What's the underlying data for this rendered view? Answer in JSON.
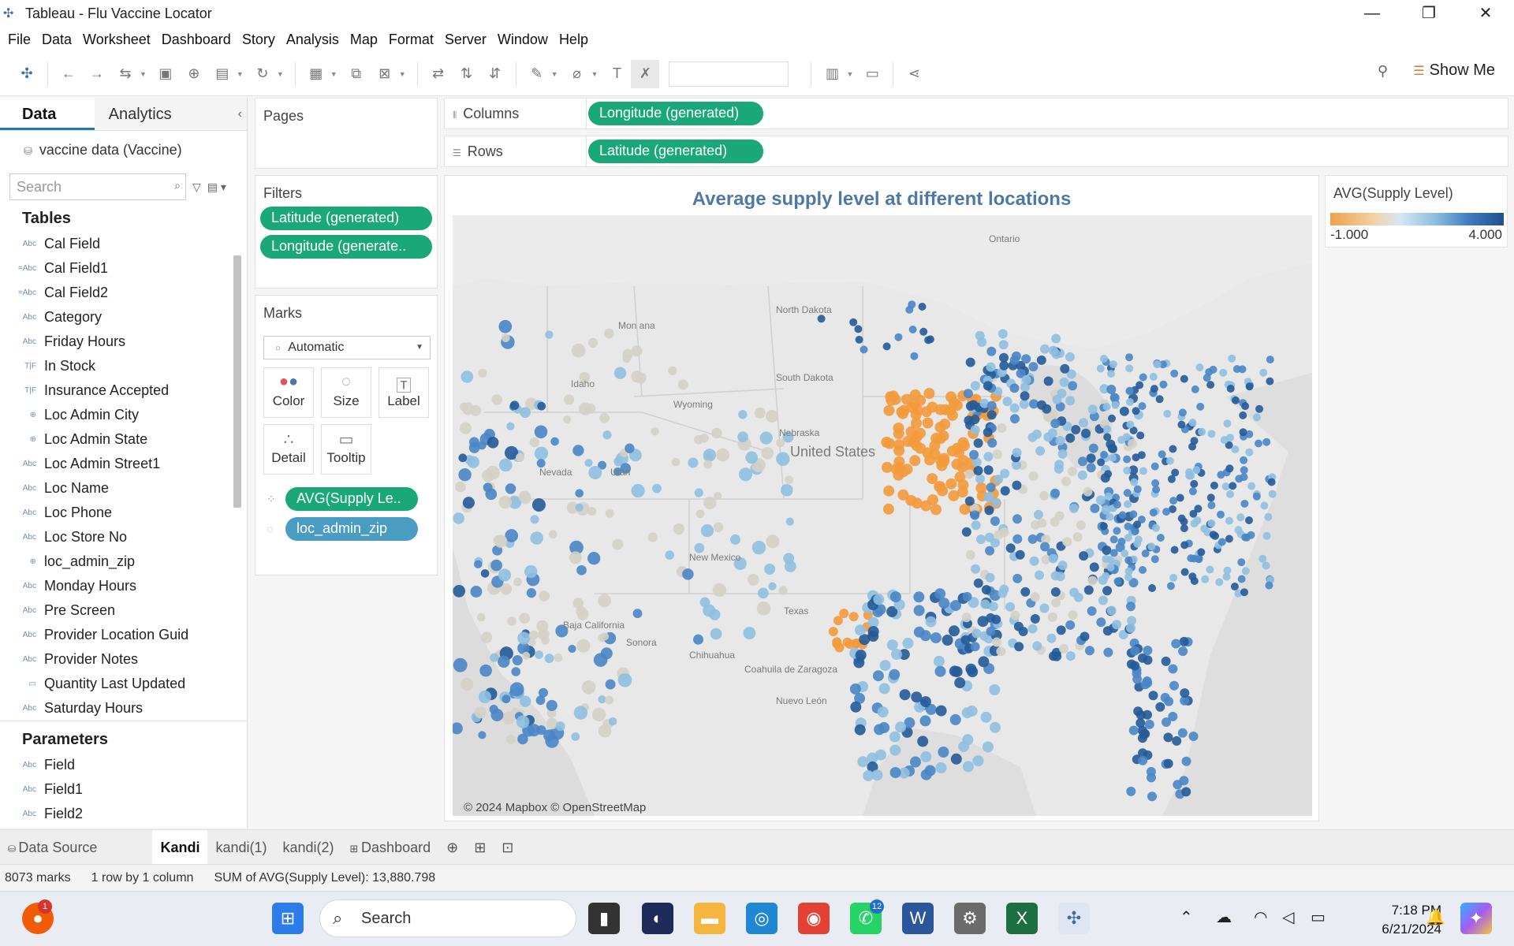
{
  "window": {
    "title": "Tableau - Flu Vaccine Locator",
    "controls": [
      "—",
      "❐",
      "✕"
    ]
  },
  "menu": [
    "File",
    "Data",
    "Worksheet",
    "Dashboard",
    "Story",
    "Analysis",
    "Map",
    "Format",
    "Server",
    "Window",
    "Help"
  ],
  "toolbar": {
    "show_me": "Show Me"
  },
  "data_pane": {
    "tab_data": "Data",
    "tab_analytics": "Analytics",
    "datasource": "vaccine data (Vaccine)",
    "search_placeholder": "Search",
    "tables_header": "Tables",
    "fields": [
      {
        "type": "Abc",
        "name": "Cal Field"
      },
      {
        "type": "=Abc",
        "name": "Cal Field1"
      },
      {
        "type": "=Abc",
        "name": "Cal Field2"
      },
      {
        "type": "Abc",
        "name": "Category"
      },
      {
        "type": "Abc",
        "name": "Friday Hours"
      },
      {
        "type": "T|F",
        "name": "In Stock"
      },
      {
        "type": "T|F",
        "name": "Insurance Accepted"
      },
      {
        "type": "⊕",
        "name": "Loc Admin City"
      },
      {
        "type": "⊕",
        "name": "Loc Admin State"
      },
      {
        "type": "Abc",
        "name": "Loc Admin Street1"
      },
      {
        "type": "Abc",
        "name": "Loc Name"
      },
      {
        "type": "Abc",
        "name": "Loc Phone"
      },
      {
        "type": "Abc",
        "name": "Loc Store No"
      },
      {
        "type": "⊕",
        "name": "loc_admin_zip"
      },
      {
        "type": "Abc",
        "name": "Monday Hours"
      },
      {
        "type": "Abc",
        "name": "Pre Screen"
      },
      {
        "type": "Abc",
        "name": "Provider Location Guid"
      },
      {
        "type": "Abc",
        "name": "Provider Notes"
      },
      {
        "type": "▭",
        "name": "Quantity Last Updated"
      },
      {
        "type": "Abc",
        "name": "Saturday Hours"
      }
    ],
    "parameters_header": "Parameters",
    "parameters": [
      {
        "type": "Abc",
        "name": "Field"
      },
      {
        "type": "Abc",
        "name": "Field1"
      },
      {
        "type": "Abc",
        "name": "Field2"
      }
    ]
  },
  "pages": {
    "title": "Pages"
  },
  "filters": {
    "title": "Filters",
    "items": [
      "Latitude (generated)",
      "Longitude (generate.."
    ]
  },
  "marks": {
    "title": "Marks",
    "type": "Automatic",
    "buttons": [
      "Color",
      "Size",
      "Label",
      "Detail",
      "Tooltip"
    ],
    "pills": [
      "AVG(Supply Le..",
      "loc_admin_zip"
    ]
  },
  "shelves": {
    "columns_label": "Columns",
    "columns_pill": "Longitude (generated)",
    "rows_label": "Rows",
    "rows_pill": "Latitude (generated)"
  },
  "viz": {
    "title": "Average supply level at different locations",
    "map_labels": [
      "Ontario",
      "North Dakota",
      "South Dakota",
      "Nebraska",
      "United States",
      "Idaho",
      "Nevada",
      "Utah",
      "Wyoming",
      "Mon ana",
      "New Mexico",
      "Texas",
      "Baja California",
      "Sonora",
      "Chihuahua",
      "Coahuila de Zaragoza",
      "Nuevo León"
    ],
    "copyright": "© 2024 Mapbox © OpenStreetMap"
  },
  "legend": {
    "title": "AVG(Supply Level)",
    "min": "-1.000",
    "max": "4.000"
  },
  "sheet_tabs": [
    "Data Source",
    "Kandi",
    "kandi(1)",
    "kandi(2)",
    "Dashboard"
  ],
  "active_sheet": "Kandi",
  "status": {
    "marks": "8073 marks",
    "dims": "1 row by 1 column",
    "sum": "SUM of AVG(Supply Level): 13,880.798"
  },
  "taskbar": {
    "search": "Search",
    "time": "7:18 PM",
    "date": "6/21/2024",
    "badges": [
      "1",
      "12"
    ]
  },
  "colors": {
    "orange": "#f39a3c",
    "light": "#d4d0c6",
    "blue_light": "#8fbfe0",
    "blue": "#4a86c5",
    "blue_dark": "#245a98",
    "pill_green": "#1aa878"
  }
}
